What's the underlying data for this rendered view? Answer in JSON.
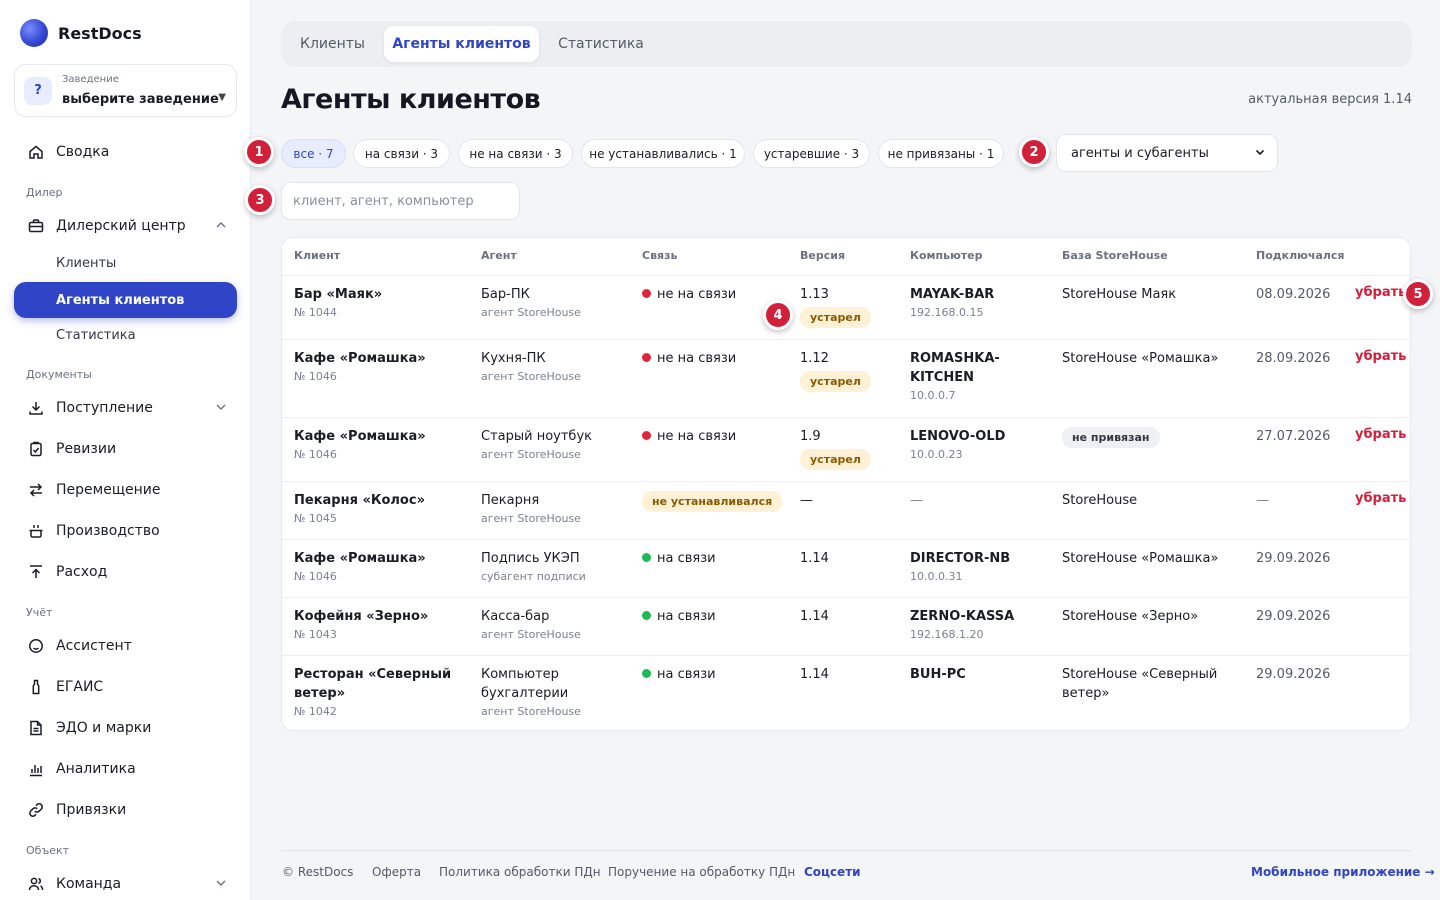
{
  "brand": {
    "name": "RestDocs"
  },
  "venue": {
    "caption": "Заведение",
    "value": "выберите заведение",
    "badge": "?"
  },
  "sidebar": {
    "summary": "Сводка",
    "section_dealer": "Дилер",
    "dealer_center": "Дилерский центр",
    "dealer_sub": [
      "Клиенты",
      "Агенты клиентов",
      "Статистика"
    ],
    "section_docs": "Документы",
    "docs": [
      "Поступление",
      "Ревизии",
      "Перемещение",
      "Производство",
      "Расход"
    ],
    "section_account": "Учёт",
    "account": [
      "Ассистент",
      "ЕГАИС",
      "ЭДО и марки",
      "Аналитика",
      "Привязки"
    ],
    "section_object": "Объект",
    "object": [
      "Команда"
    ]
  },
  "tabs": [
    "Клиенты",
    "Агенты клиентов",
    "Статистика"
  ],
  "page": {
    "title": "Агенты клиентов",
    "version": "актуальная версия 1.14"
  },
  "filters": [
    "все · 7",
    "на связи · 3",
    "не на связи · 3",
    "не устанавливались · 1",
    "устаревшие · 3",
    "не привязаны · 1"
  ],
  "agent_type": {
    "value": "агенты и субагенты"
  },
  "search": {
    "placeholder": "клиент, агент, компьютер"
  },
  "markers": [
    "1",
    "2",
    "3",
    "4",
    "5"
  ],
  "table": {
    "columns": [
      "Клиент",
      "Агент",
      "Связь",
      "Версия",
      "Компьютер",
      "База StoreHouse",
      "Подключался"
    ],
    "rows": [
      {
        "client": "Бар «Маяк»",
        "client_no": "№ 1044",
        "agent": "Бар-ПК",
        "agent_type": "агент StoreHouse",
        "status": "не на связи",
        "version": "1.13",
        "version_badge": "устарел",
        "computer": "MAYAK-BAR",
        "ip": "192.168.0.15",
        "base": "StoreHouse Маяк",
        "connected": "08.09.2026",
        "action": "убрать"
      },
      {
        "client": "Кафе «Ромашка»",
        "client_no": "№ 1046",
        "agent": "Кухня-ПК",
        "agent_type": "агент StoreHouse",
        "status": "не на связи",
        "version": "1.12",
        "version_badge": "устарел",
        "computer": "ROMASHKA-KITCHEN",
        "ip": "10.0.0.7",
        "base": "StoreHouse «Ромашка»",
        "connected": "28.09.2026",
        "action": "убрать"
      },
      {
        "client": "Кафе «Ромашка»",
        "client_no": "№ 1046",
        "agent": "Старый ноутбук",
        "agent_type": "агент StoreHouse",
        "status": "не на связи",
        "version": "1.9",
        "version_badge": "устарел",
        "computer": "LENOVO-OLD",
        "ip": "10.0.0.23",
        "base": "не привязан",
        "connected": "27.07.2026",
        "action": "убрать"
      },
      {
        "client": "Пекарня «Колос»",
        "client_no": "№ 1045",
        "agent": "Пекарня",
        "agent_type": "агент StoreHouse",
        "status": "не устанавливался",
        "version": "—",
        "computer": "—",
        "base": "StoreHouse",
        "connected": "—",
        "action": "убрать"
      },
      {
        "client": "Кафе «Ромашка»",
        "client_no": "№ 1046",
        "agent": "Подпись УКЭП",
        "agent_type": "субагент подписи",
        "status": "на связи",
        "version": "1.14",
        "computer": "DIRECTOR-NB",
        "ip": "10.0.0.31",
        "base": "StoreHouse «Ромашка»",
        "connected": "29.09.2026"
      },
      {
        "client": "Кофейня «Зерно»",
        "client_no": "№ 1043",
        "agent": "Касса-бар",
        "agent_type": "агент StoreHouse",
        "status": "на связи",
        "version": "1.14",
        "computer": "ZERNO-KASSA",
        "ip": "192.168.1.20",
        "base": "StoreHouse «Зерно»",
        "connected": "29.09.2026"
      },
      {
        "client": "Ресторан «Северный ветер»",
        "client_no": "№ 1042",
        "agent": "Компьютер бухгалтерии",
        "agent_type": "агент StoreHouse",
        "status": "на связи",
        "version": "1.14",
        "computer": "BUH-PC",
        "base": "StoreHouse «Северный ветер»",
        "connected": "29.09.2026"
      }
    ]
  },
  "footer": {
    "copyright": "© RestDocs",
    "links": [
      "Оферта",
      "Политика обработки ПДн",
      "Поручение на обработку ПДн"
    ],
    "social": "Соцсети",
    "mobile": "Мобильное приложение →"
  },
  "colors": {
    "accent": "#2f44c7",
    "danger": "#d2203a",
    "online": "#1db954",
    "offline": "#e0243a",
    "warn_bg": "#fff1d6"
  }
}
